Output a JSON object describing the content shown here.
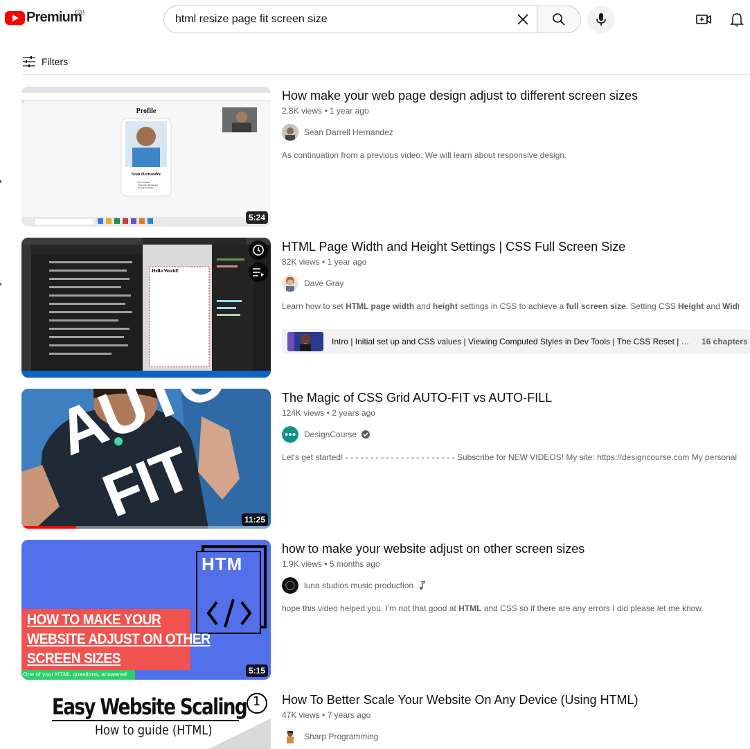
{
  "header": {
    "logo_text": "Premium",
    "country": "GB",
    "search_value": "html resize page fit screen size"
  },
  "filters": {
    "label": "Filters"
  },
  "results": [
    {
      "title": "How make your web page design adjust to different screen sizes",
      "views": "2.8K views",
      "age": "1 year ago",
      "channel": "Sean Darrell Hernandez",
      "description": "As continuation from a previous video. We will learn about responsive design.",
      "duration": "5:24",
      "thumb": {
        "heading": "Profile",
        "name": "Sean Hernandez",
        "items": [
          "Ace Teacher",
          "Javascript Developer",
          "Startup Founder"
        ]
      }
    },
    {
      "title": "HTML Page Width and Height Settings | CSS Full Screen Size",
      "views": "82K views",
      "age": "1 year ago",
      "channel": "Dave Gray",
      "description_parts": [
        "Learn how to set ",
        "HTML page width",
        " and ",
        "height",
        " settings in CSS to achieve a ",
        "full screen size",
        ". Setting CSS ",
        "Height",
        " and ",
        "Width",
        " ..."
      ],
      "chapters_text": "Intro | Initial set up and CSS values | Viewing Computed Styles in Dev Tools | The CSS Reset | The...",
      "chapters_count": "16 chapters",
      "thumb": {
        "hello": "Hello World!"
      }
    },
    {
      "title": "The Magic of CSS Grid AUTO-FIT vs AUTO-FILL",
      "views": "124K views",
      "age": "2 years ago",
      "channel": "DesignCourse",
      "description": "Let's get started! - - - - - - - - - - - - - - - - - - - - - - Subscribe for NEW VIDEOS! My site: https://designcourse.com My personal FB ...",
      "duration": "11:25",
      "watched_fraction": 0.22,
      "thumb": {
        "line1": "AUTO",
        "line2": "FIT"
      }
    },
    {
      "title": "how to make your website adjust on other screen sizes",
      "views": "1.9K views",
      "age": "5 months ago",
      "channel": "luna studios music production",
      "description_parts": [
        "hope this video helped you. I'm not that good at ",
        "HTML",
        " and CSS so if there are any errors I did please let me know."
      ],
      "duration": "5:15",
      "thumb": {
        "badge": "HTM",
        "lines": [
          "HOW TO MAKE YOUR",
          "WEBSITE ADJUST ON OTHER",
          "SCREEN SIZES"
        ],
        "footer": "One of your HTML questions, answered"
      }
    },
    {
      "title": "How To Better Scale Your Website On Any Device (Using HTML)",
      "views": "47K views",
      "age": "7 years ago",
      "channel": "Sharp Programming",
      "thumb": {
        "line1": "Easy Website Scaling",
        "line2": "How to guide (HTML)",
        "number": "1"
      }
    }
  ]
}
